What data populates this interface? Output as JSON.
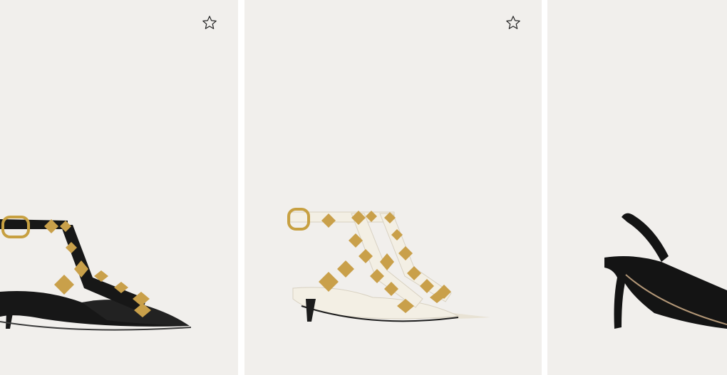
{
  "products": [
    {
      "image_alt": "black-rockstud-kitten-heel-pump-icon",
      "wishlist_icon": "star-outline-icon",
      "colors": {
        "leather": "#171717",
        "stud": "#c9a04a",
        "buckle": "#c7a041"
      }
    },
    {
      "image_alt": "ivory-rockstud-kitten-heel-pump-icon",
      "wishlist_icon": "star-outline-icon",
      "colors": {
        "leather": "#f3efe4",
        "stud": "#c9a04a",
        "buckle": "#c7a041"
      }
    },
    {
      "image_alt": "black-slingback-pump-icon",
      "colors": {
        "leather": "#141414"
      }
    }
  ],
  "theme": {
    "card_background": "#f1efec",
    "page_background": "#ffffff"
  }
}
